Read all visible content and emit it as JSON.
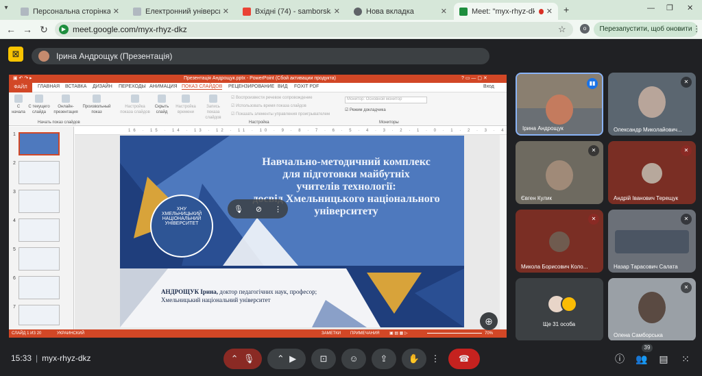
{
  "tabs": [
    {
      "label": "Персональна сторінка виклад",
      "icon": "page-icon",
      "active": false
    },
    {
      "label": "Електронний університет",
      "icon": "page-icon",
      "active": false
    },
    {
      "label": "Вхідні (74) - samborskaov@khr",
      "icon": "gmail-icon",
      "active": false
    },
    {
      "label": "Нова вкладка",
      "icon": "chrome-icon",
      "active": false
    },
    {
      "label": "Meet: \"myx-rhyz-dkz\"",
      "icon": "meet-icon",
      "active": true
    }
  ],
  "new_tab": "+",
  "url": "meet.google.com/myx-rhyz-dkz",
  "relaunch_label": "Перезапустити, щоб оновити дані",
  "presenter_label": "Ірина Андрощук (Презентація)",
  "powerpoint": {
    "window_title": "Презентація Андрощук.pptx - PowerPoint (Сбой активации продукта)",
    "sign_in": "Вход",
    "menu": [
      "ФАЙЛ",
      "ГЛАВНАЯ",
      "ВСТАВКА",
      "ДИЗАЙН",
      "ПЕРЕХОДЫ",
      "АНИМАЦИЯ",
      "ПОКАЗ СЛАЙДОВ",
      "РЕЦЕНЗИРОВАНИЕ",
      "ВИД",
      "FOXIT PDF"
    ],
    "ribbon": {
      "from_start": "С начала",
      "from_current": "С текущего слайда",
      "online": "Онлайн-презентация",
      "custom": "Произвольный показ",
      "group1": "Начать показ слайдов",
      "setup": "Настройка показа слайдов",
      "hide": "Скрыть слайд",
      "rehearse": "Настройка времени",
      "record": "Запись показа слайдов",
      "chk1": "Воспроизвести речевое сопровождение",
      "chk2": "Использовать время показа слайдов",
      "chk3": "Показать элементы управления проигрывателем",
      "group2": "Настройка",
      "monitor": "Монитор: Основной монитор",
      "presenter_view": "Режим докладчика",
      "group3": "Мониторы"
    },
    "ruler": "16 · 15 · 14 · 13 · 12 · 11 · 10 · 9 · 8 · 7 · 6 · 5 · 4 · 3 · 2 · 1 · 0 · 1 · 2 · 3 · 4 · 5 · 6 · 7 · 8 · 9 · 10 · 11 · 12 · 13 · 14 · 15 · 16",
    "thumbs": [
      "1",
      "2",
      "3",
      "4",
      "5",
      "6",
      "7"
    ],
    "slide": {
      "title_lines": [
        "Навчально-методичний комплекс",
        "для підготовки майбутніх",
        "учителів технології:",
        "досвід Хмельницького національного",
        "університету"
      ],
      "author_name": "АНДРОЩУК Ірина,",
      "author_rest": " доктор педагогічних наук, професор;",
      "author_uni": "Хмельницький національний університет",
      "logo_text": "ХНУ ХМЕЛЬНИЦЬКИЙ НАЦІОНАЛЬНИЙ УНІВЕРСИТЕТ"
    },
    "status": {
      "slide": "СЛАЙД 1 ИЗ 20",
      "lang": "УКРАИНСКИЙ",
      "notes": "ЗАМЕТКИ",
      "comments": "ПРИМЕЧАНИЯ",
      "zoom": "70%"
    }
  },
  "participants": [
    {
      "name": "Ірина Андрощук",
      "mic": "speaking"
    },
    {
      "name": "Олександр Миколайович...",
      "mic": "muted"
    },
    {
      "name": "Євген Кулик",
      "mic": "muted"
    },
    {
      "name": "Андрій Іванович Терещук",
      "mic": "muted-red"
    },
    {
      "name": "Микола Борисович Коло...",
      "mic": "muted-red"
    },
    {
      "name": "Назар Тарасович Салата",
      "mic": "muted"
    },
    {
      "name": "Ще 31 особа",
      "mic": ""
    },
    {
      "name": "Олена Самборська",
      "mic": "muted"
    }
  ],
  "clock": "15:33",
  "meeting_code": "myx-rhyz-dkz",
  "people_count": "39"
}
